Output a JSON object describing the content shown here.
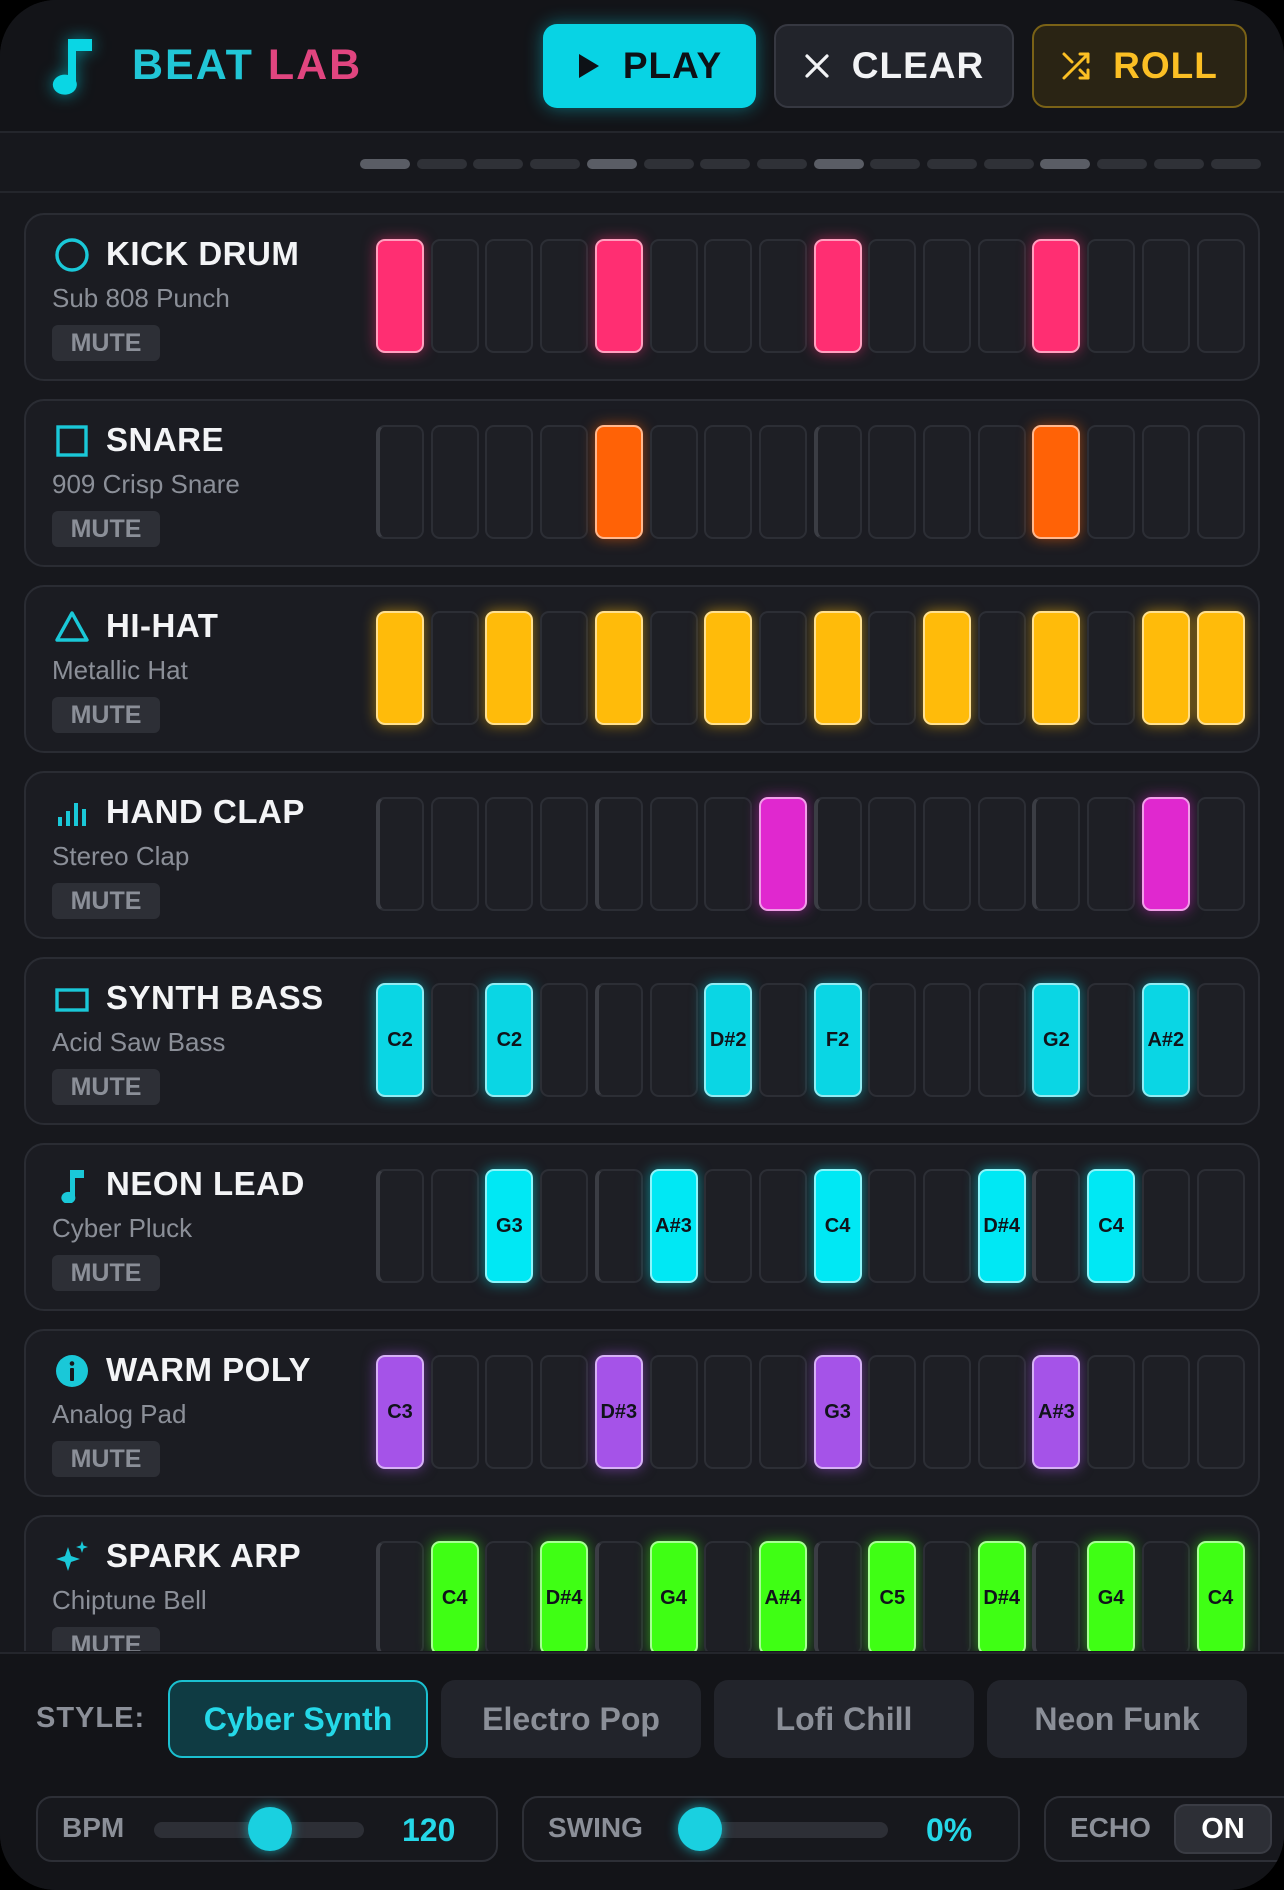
{
  "header": {
    "title_part1": "BEAT",
    "title_part2": "LAB",
    "logo_icon": "music-note-icon",
    "play_label": "PLAY",
    "clear_label": "CLEAR",
    "roll_label": "ROLL"
  },
  "sequencer": {
    "steps": 16,
    "current_step_group": 1
  },
  "tracks": [
    {
      "name": "KICK DRUM",
      "sub": "Sub 808 Punch",
      "mute": "MUTE",
      "icon": "circle-icon",
      "color": "#ff2e72",
      "glow": "rgba(255,46,114,.55)",
      "pattern": [
        1,
        0,
        0,
        0,
        1,
        0,
        0,
        0,
        1,
        0,
        0,
        0,
        1,
        0,
        0,
        0
      ],
      "notes": [
        "",
        "",
        "",
        "",
        "",
        "",
        "",
        "",
        "",
        "",
        "",
        "",
        "",
        "",
        "",
        ""
      ]
    },
    {
      "name": "SNARE",
      "sub": "909 Crisp Snare",
      "mute": "MUTE",
      "icon": "square-icon",
      "color": "#ff6206",
      "glow": "rgba(255,98,6,.55)",
      "pattern": [
        0,
        0,
        0,
        0,
        1,
        0,
        0,
        0,
        0,
        0,
        0,
        0,
        1,
        0,
        0,
        0
      ],
      "notes": [
        "",
        "",
        "",
        "",
        "",
        "",
        "",
        "",
        "",
        "",
        "",
        "",
        "",
        "",
        "",
        ""
      ]
    },
    {
      "name": "HI-HAT",
      "sub": "Metallic Hat",
      "mute": "MUTE",
      "icon": "triangle-icon",
      "color": "#ffbb0a",
      "glow": "rgba(255,187,10,.55)",
      "pattern": [
        1,
        0,
        1,
        0,
        1,
        0,
        1,
        0,
        1,
        0,
        1,
        0,
        1,
        0,
        1,
        1
      ],
      "notes": [
        "",
        "",
        "",
        "",
        "",
        "",
        "",
        "",
        "",
        "",
        "",
        "",
        "",
        "",
        "",
        ""
      ]
    },
    {
      "name": "HAND CLAP",
      "sub": "Stereo Clap",
      "mute": "MUTE",
      "icon": "bars-icon",
      "color": "#e028cf",
      "glow": "rgba(224,40,207,.55)",
      "pattern": [
        0,
        0,
        0,
        0,
        0,
        0,
        0,
        1,
        0,
        0,
        0,
        0,
        0,
        0,
        1,
        0
      ],
      "notes": [
        "",
        "",
        "",
        "",
        "",
        "",
        "",
        "",
        "",
        "",
        "",
        "",
        "",
        "",
        "",
        ""
      ]
    },
    {
      "name": "SYNTH BASS",
      "sub": "Acid Saw Bass",
      "mute": "MUTE",
      "icon": "rectangle-icon",
      "color": "#0ad6e4",
      "glow": "rgba(10,214,228,.55)",
      "pattern": [
        1,
        0,
        1,
        0,
        0,
        0,
        1,
        0,
        1,
        0,
        0,
        0,
        1,
        0,
        1,
        0
      ],
      "notes": [
        "C2",
        "",
        "C2",
        "",
        "",
        "",
        "D#2",
        "",
        "F2",
        "",
        "",
        "",
        "G2",
        "",
        "A#2",
        ""
      ]
    },
    {
      "name": "NEON LEAD",
      "sub": "Cyber Pluck",
      "mute": "MUTE",
      "icon": "music-note-icon",
      "color": "#00e8f4",
      "glow": "rgba(0,232,244,.55)",
      "pattern": [
        0,
        0,
        1,
        0,
        0,
        1,
        0,
        0,
        1,
        0,
        0,
        1,
        0,
        1,
        0,
        0
      ],
      "notes": [
        "",
        "",
        "G3",
        "",
        "",
        "A#3",
        "",
        "",
        "C4",
        "",
        "",
        "D#4",
        "",
        "C4",
        "",
        ""
      ]
    },
    {
      "name": "WARM POLY",
      "sub": "Analog Pad",
      "mute": "MUTE",
      "icon": "info-icon",
      "color": "#a553e8",
      "glow": "rgba(165,83,232,.55)",
      "pattern": [
        1,
        0,
        0,
        0,
        1,
        0,
        0,
        0,
        1,
        0,
        0,
        0,
        1,
        0,
        0,
        0
      ],
      "notes": [
        "C3",
        "",
        "",
        "",
        "D#3",
        "",
        "",
        "",
        "G3",
        "",
        "",
        "",
        "A#3",
        "",
        "",
        ""
      ]
    },
    {
      "name": "SPARK ARP",
      "sub": "Chiptune Bell",
      "mute": "MUTE",
      "icon": "sparkle-icon",
      "color": "#3fff14",
      "glow": "rgba(63,255,20,.55)",
      "pattern": [
        0,
        1,
        0,
        1,
        0,
        1,
        0,
        1,
        0,
        1,
        0,
        1,
        0,
        1,
        0,
        1
      ],
      "notes": [
        "",
        "C4",
        "",
        "D#4",
        "",
        "G4",
        "",
        "A#4",
        "",
        "C5",
        "",
        "D#4",
        "",
        "G4",
        "",
        "C4"
      ]
    }
  ],
  "bottom": {
    "style_label": "STYLE:",
    "styles": [
      "Cyber Synth",
      "Electro Pop",
      "Lofi Chill",
      "Neon Funk"
    ],
    "active_style": 0,
    "bpm_label": "BPM",
    "bpm_value": "120",
    "bpm_fraction": 0.5,
    "swing_label": "SWING",
    "swing_value": "0%",
    "swing_fraction": 0.0,
    "echo_label": "ECHO",
    "echo_value": "ON"
  },
  "colors": {
    "accent": "#08d3e4",
    "roll": "#fbbf24",
    "title_pink": "#e0457f"
  }
}
